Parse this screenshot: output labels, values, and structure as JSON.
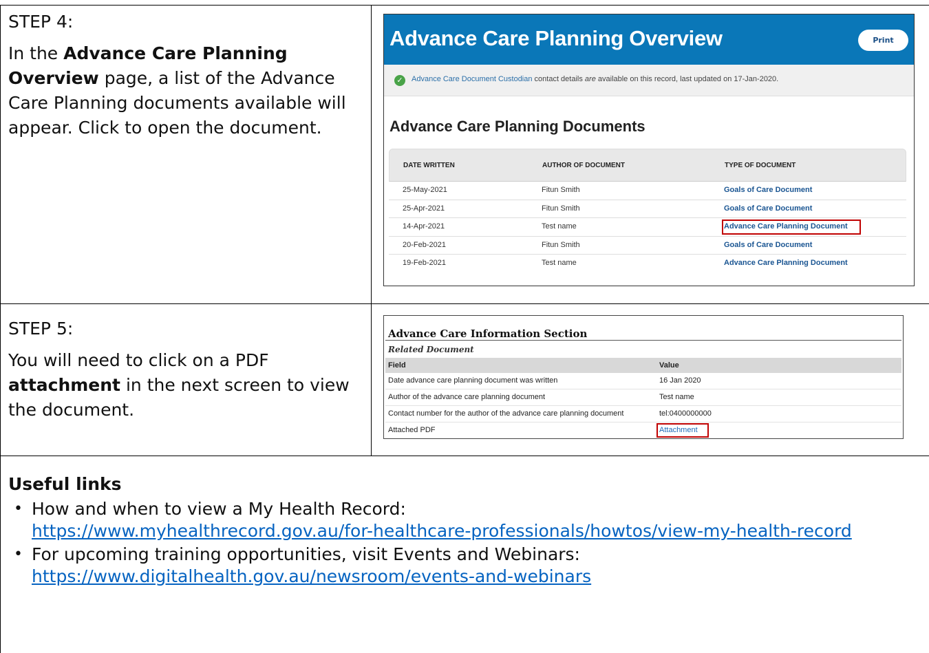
{
  "step4": {
    "title": "STEP 4:",
    "text_a": "In the ",
    "text_bold": "Advance Care Planning Overview",
    "text_b": " page, a list of the Advance Care Planning documents available will appear. Click to open the document."
  },
  "acp_overview": {
    "title": "Advance Care Planning Overview",
    "print_label": "Print",
    "notice_link": "Advance Care Document Custodian",
    "notice_text_a": " contact details ",
    "notice_emphasis": "are",
    "notice_text_b": " available on this record, last updated on 17-Jan-2020.",
    "section_title": "Advance Care Planning Documents",
    "columns": [
      "DATE WRITTEN",
      "AUTHOR OF DOCUMENT",
      "TYPE OF DOCUMENT"
    ],
    "rows": [
      {
        "date": "25-May-2021",
        "author": "Fitun Smith",
        "type": "Goals of Care Document"
      },
      {
        "date": "25-Apr-2021",
        "author": "Fitun Smith",
        "type": "Goals of Care Document"
      },
      {
        "date": "14-Apr-2021",
        "author": "Test name",
        "type": "Advance Care Planning Document"
      },
      {
        "date": "20-Feb-2021",
        "author": "Fitun Smith",
        "type": "Goals of Care Document"
      },
      {
        "date": "19-Feb-2021",
        "author": "Test name",
        "type": "Advance Care Planning Document"
      }
    ]
  },
  "step5": {
    "title": "STEP 5:",
    "text_a": "You will need to click on a PDF ",
    "text_bold": "attachment",
    "text_b": " in the next screen to view the document."
  },
  "acp_info": {
    "title": "Advance Care Information Section",
    "subtitle": "Related Document",
    "headers": [
      "Field",
      "Value"
    ],
    "rows": [
      {
        "field": "Date advance care planning document was written",
        "value": "16 Jan 2020"
      },
      {
        "field": "Author of the advance care planning document",
        "value": "Test name"
      },
      {
        "field": "Contact number for the author of the advance care planning document",
        "value": "tel:0400000000"
      },
      {
        "field": "Attached PDF",
        "value": "Attachment"
      }
    ]
  },
  "useful_links": {
    "heading": "Useful links",
    "items": [
      {
        "text": "How and when to view a My Health Record:",
        "url": "https://www.myhealthrecord.gov.au/for-healthcare-professionals/howtos/view-my-health-record"
      },
      {
        "text": "For upcoming training opportunities, visit Events and Webinars:",
        "url": "https://www.digitalhealth.gov.au/newsroom/events-and-webinars"
      }
    ]
  },
  "colors": {
    "banner_blue": "#0a77b8",
    "highlight_red": "#c00000",
    "link_blue": "#0563c1"
  }
}
